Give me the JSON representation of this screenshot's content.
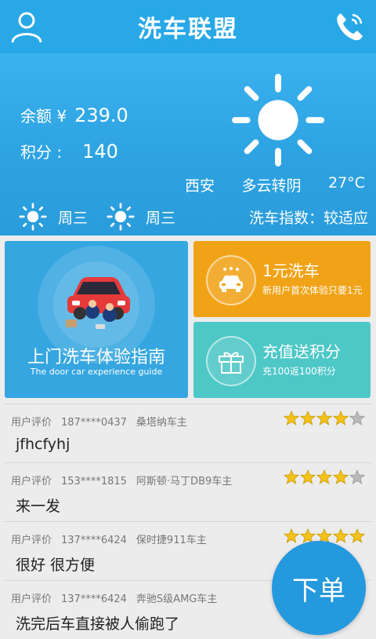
{
  "header": {
    "title": "洗车联盟",
    "left_icon": "user-icon",
    "right_icon": "phone-icon"
  },
  "account": {
    "balance_label": "余额 ¥",
    "balance_value": "239.0",
    "points_label": "积分 :",
    "points_value": "140"
  },
  "weather": {
    "icon": "sun-icon",
    "city": "西安",
    "condition": "多云转阴",
    "temperature": "27°C",
    "forecast": [
      {
        "day": "周三",
        "icon": "sun-icon"
      },
      {
        "day": "周三",
        "icon": "sun-icon"
      }
    ],
    "wash_index": "洗车指数：较适应"
  },
  "tiles": {
    "guide": {
      "title": "上门洗车体验指南",
      "subtitle": "The door car experience guide",
      "color": "#35a6e0"
    },
    "wash": {
      "title": "1元洗车",
      "subtitle": "新用户首次体验只要1元",
      "color": "#f1a318",
      "icon": "car-wash-icon"
    },
    "recharge": {
      "title": "充值送积分",
      "subtitle": "充100返100积分",
      "color": "#4ec7c7",
      "icon": "gift-icon"
    }
  },
  "reviews": [
    {
      "label": "用户评价",
      "phone": "187****0437",
      "car": "桑塔纳车主",
      "content": "jfhcfyhj",
      "rating": 4
    },
    {
      "label": "用户评价",
      "phone": "153****1815",
      "car": "阿斯顿·马丁DB9车主",
      "content": "来一发",
      "rating": 4
    },
    {
      "label": "用户评价",
      "phone": "137****6424",
      "car": "保时捷911车主",
      "content": "很好 很方便",
      "rating": 5
    },
    {
      "label": "用户评价",
      "phone": "137****6424",
      "car": "奔驰S级AMG车主",
      "content": "洗完后车直接被人偷跑了",
      "rating": 5
    }
  ],
  "order_button": {
    "label": "下单",
    "color": "#2499de"
  },
  "colors": {
    "primary": "#28a8e6",
    "star": "#f3c21b",
    "star_empty": "#b9b9b9"
  }
}
